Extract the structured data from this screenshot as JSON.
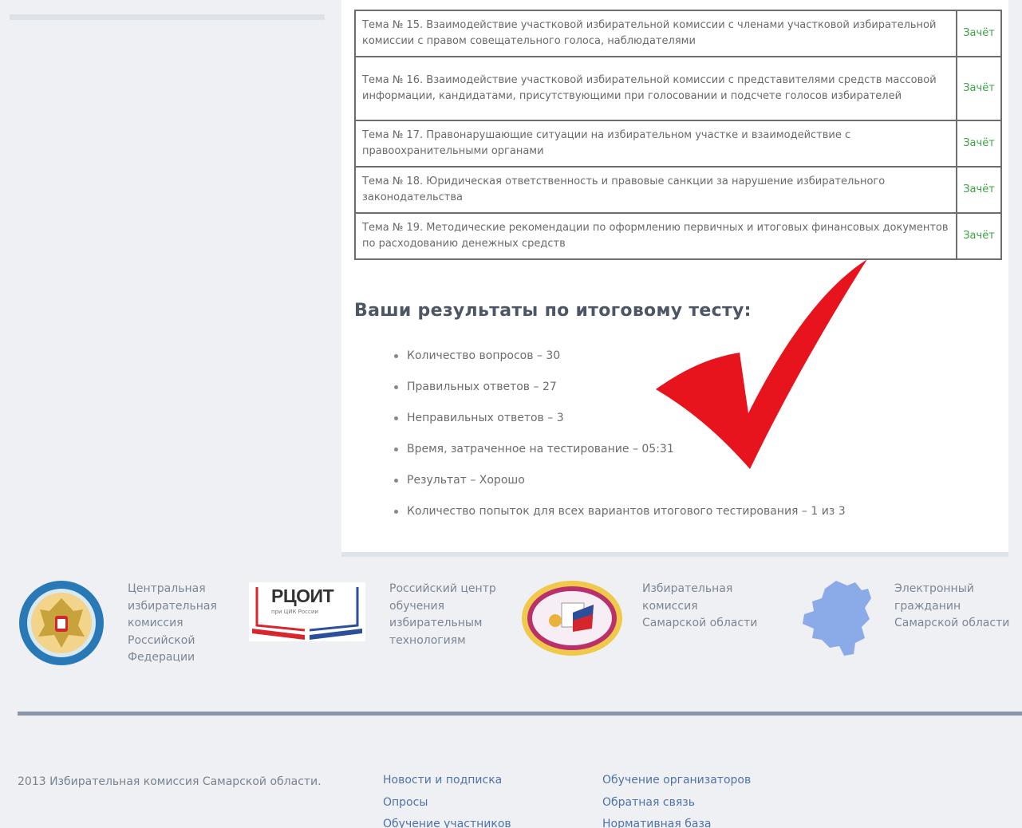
{
  "topics": [
    {
      "text": "Тема № 15. Взаимодействие участковой избирательной комиссии с членами участковой избирательной комиссии с правом совещательного голоса, наблюдателями",
      "status": "Зачёт"
    },
    {
      "text": "Тема № 16. Взаимодействие участковой избирательной комиссии с представителями средств массовой информации, кандидатами, присутствующими при голосовании и подсчете голосов избирателей",
      "status": "Зачёт"
    },
    {
      "text": "Тема № 17. Правонарушающие ситуации на избирательном участке и взаимодействие с правоохранительными органами",
      "status": "Зачёт"
    },
    {
      "text": "Тема № 18. Юридическая ответственность и правовые санкции за нарушение избирательного законодательства",
      "status": "Зачёт"
    },
    {
      "text": "Тема № 19. Методические рекомендации по оформлению первичных и итоговых финансовых документов по расходованию денежных средств",
      "status": "Зачёт"
    }
  ],
  "results": {
    "title": "Ваши результаты по итоговому тесту:",
    "items": [
      "Количество вопросов – 30",
      "Правильных ответов – 27",
      "Неправильных ответов – 3",
      "Время, затраченное на тестирование – 05:31",
      "Результат – Хорошо",
      "Количество попыток для всех вариантов итогового тестирования – 1 из 3"
    ]
  },
  "partners": {
    "cik": [
      "Центральная",
      "избирательная",
      "комиссия",
      "Российской",
      "Федерации"
    ],
    "rcoit_logo_main": "РЦОИТ",
    "rcoit_logo_sub": "при ЦИК России",
    "rcoit": [
      "Российский центр",
      "обучения",
      "избирательным",
      "технологиям"
    ],
    "samara_commission": [
      "Избирательная",
      "комиссия",
      "Самарской области"
    ],
    "citizen": [
      "Электронный",
      "гражданин",
      "Самарской области"
    ]
  },
  "footer": {
    "copyright": "2013 Избирательная комиссия Самарской области.",
    "col1": [
      "Новости и подписка",
      "Опросы",
      "Обучение участников"
    ],
    "col2": [
      "Обучение организаторов",
      "Обратная связь",
      "Нормативная база"
    ]
  },
  "colors": {
    "status_green": "#3ea346",
    "checkmark_red": "#e8141d",
    "link_blue": "#4f73a8",
    "footer_rule": "#8896aa"
  }
}
